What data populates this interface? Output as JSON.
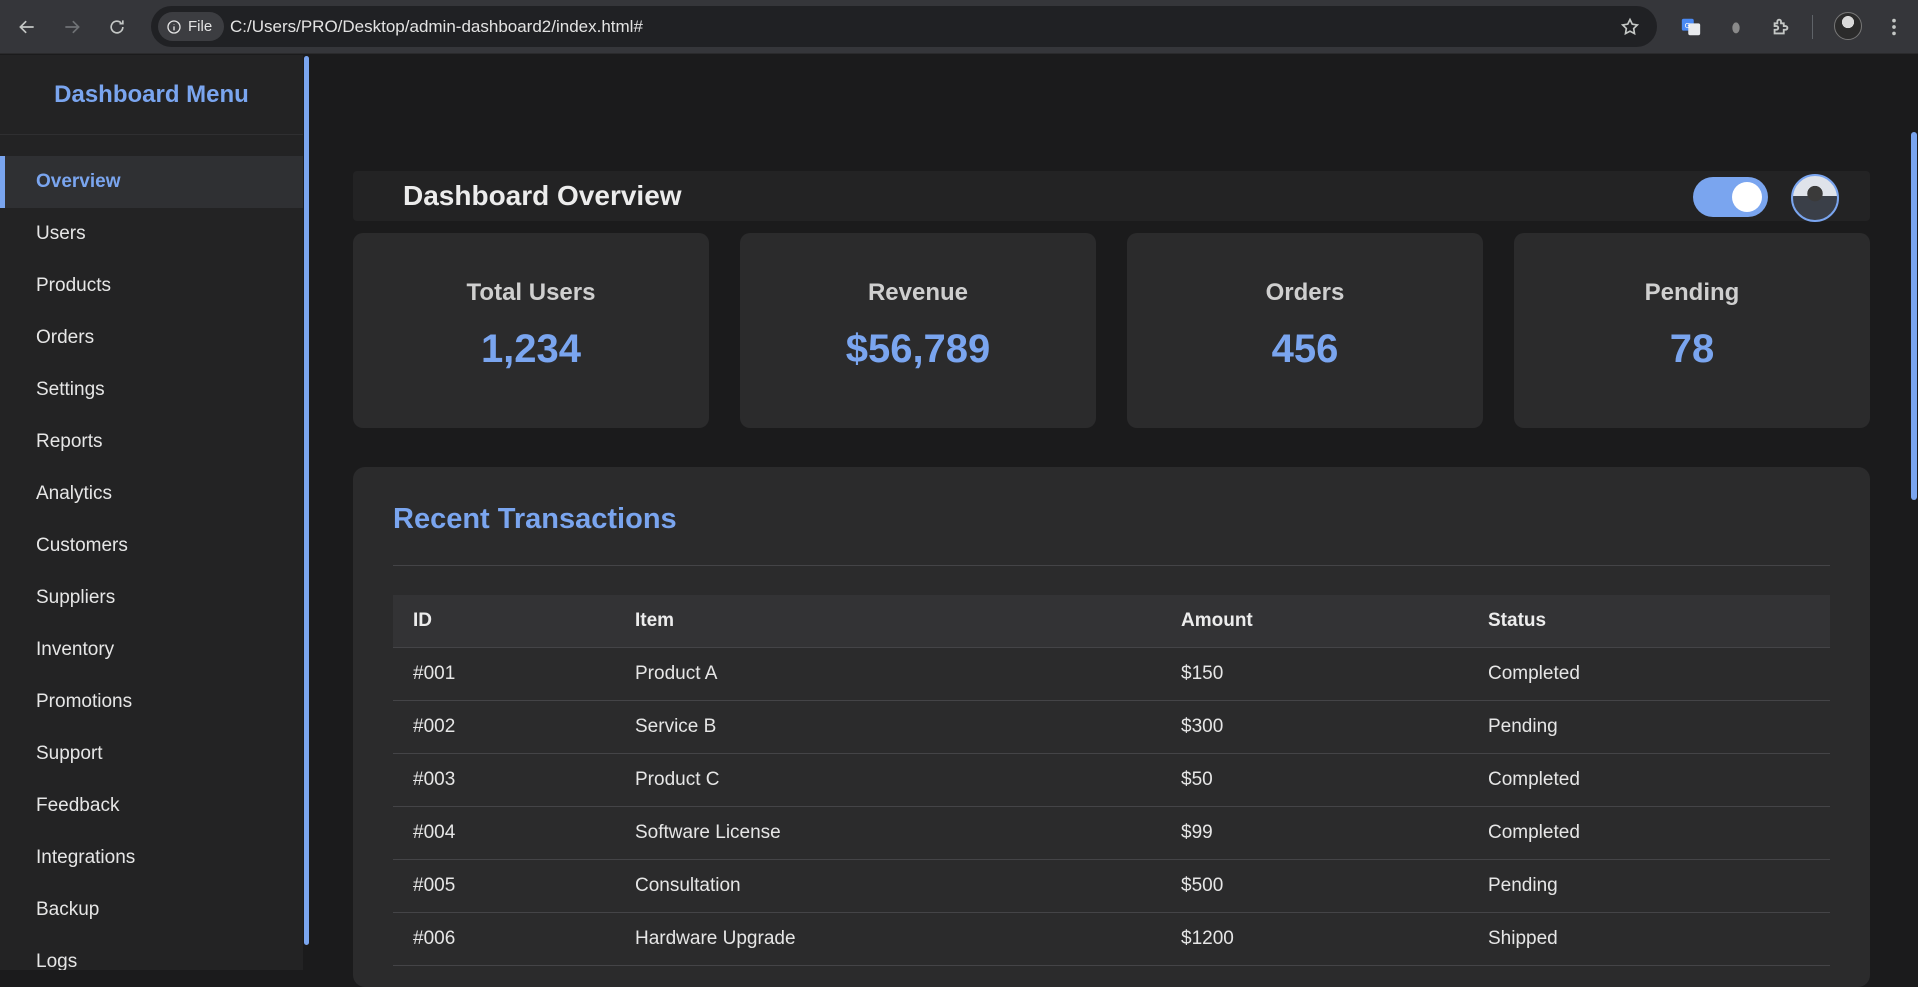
{
  "browser": {
    "site_chip_label": "File",
    "url": "C:/Users/PRO/Desktop/admin-dashboard2/index.html#"
  },
  "sidebar": {
    "title": "Dashboard Menu",
    "items": [
      {
        "label": "Overview",
        "active": true
      },
      {
        "label": "Users"
      },
      {
        "label": "Products"
      },
      {
        "label": "Orders"
      },
      {
        "label": "Settings"
      },
      {
        "label": "Reports"
      },
      {
        "label": "Analytics"
      },
      {
        "label": "Customers"
      },
      {
        "label": "Suppliers"
      },
      {
        "label": "Inventory"
      },
      {
        "label": "Promotions"
      },
      {
        "label": "Support"
      },
      {
        "label": "Feedback"
      },
      {
        "label": "Integrations"
      },
      {
        "label": "Backup"
      },
      {
        "label": "Logs"
      }
    ]
  },
  "header": {
    "title": "Dashboard Overview",
    "theme_toggle_on": true
  },
  "stats": [
    {
      "label": "Total Users",
      "value": "1,234"
    },
    {
      "label": "Revenue",
      "value": "$56,789"
    },
    {
      "label": "Orders",
      "value": "456"
    },
    {
      "label": "Pending",
      "value": "78"
    }
  ],
  "transactions": {
    "title": "Recent Transactions",
    "columns": [
      "ID",
      "Item",
      "Amount",
      "Status"
    ],
    "rows": [
      [
        "#001",
        "Product A",
        "$150",
        "Completed"
      ],
      [
        "#002",
        "Service B",
        "$300",
        "Pending"
      ],
      [
        "#003",
        "Product C",
        "$50",
        "Completed"
      ],
      [
        "#004",
        "Software License",
        "$99",
        "Completed"
      ],
      [
        "#005",
        "Consultation",
        "$500",
        "Pending"
      ],
      [
        "#006",
        "Hardware Upgrade",
        "$1200",
        "Shipped"
      ]
    ]
  },
  "colors": {
    "accent": "#7aa5ef",
    "background": "#1b1b1c",
    "panel": "#2b2b2c",
    "sidebar": "#232324"
  }
}
